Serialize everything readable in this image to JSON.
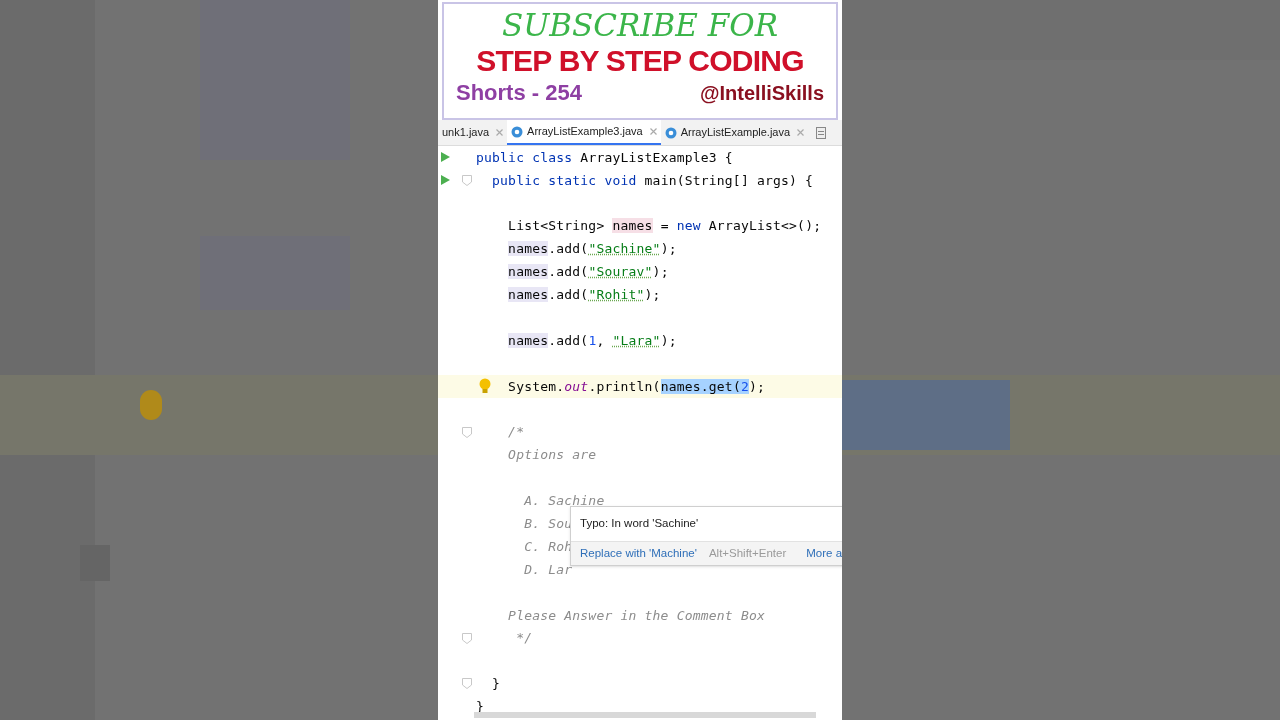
{
  "banner": {
    "headline": "SUBSCRIBE FOR",
    "subhead": "STEP BY STEP CODING",
    "episode": "Shorts - 254",
    "channel": "@IntelliSkills"
  },
  "tabs": [
    {
      "label": "unk1.java",
      "selected": false,
      "kind": "plain"
    },
    {
      "label": "ArrayListExample3.java",
      "selected": true,
      "kind": "class"
    },
    {
      "label": "ArrayListExample.java",
      "selected": false,
      "kind": "class"
    }
  ],
  "lines": [
    {
      "run": true,
      "fold": false,
      "current": false,
      "segments": [
        {
          "text": "public class",
          "kind": "keyword"
        },
        {
          "text": " ArrayListExample3 {",
          "kind": "plain"
        }
      ]
    },
    {
      "run": true,
      "fold": true,
      "current": false,
      "segments": [
        {
          "text": "  public static void",
          "kind": "keyword"
        },
        {
          "text": " main(String[] args) {",
          "kind": "plain"
        }
      ]
    },
    {
      "run": false,
      "fold": false,
      "current": false
    },
    {
      "run": false,
      "fold": false,
      "current": false,
      "segments": [
        {
          "text": "    List<String> ",
          "kind": "plain"
        },
        {
          "text": "names",
          "kind": "plain",
          "declaration": true
        },
        {
          "text": " = ",
          "kind": "plain"
        },
        {
          "text": "new",
          "kind": "keyword"
        },
        {
          "text": " ArrayList<>();",
          "kind": "plain"
        }
      ]
    },
    {
      "run": false,
      "fold": false,
      "current": false,
      "segments": [
        {
          "text": "    names",
          "kind": "plain",
          "usage": true
        },
        {
          "text": ".add(",
          "kind": "plain"
        },
        {
          "text": "\"Sachine\"",
          "kind": "string"
        },
        {
          "text": ");",
          "kind": "plain"
        }
      ]
    },
    {
      "run": false,
      "fold": false,
      "current": false,
      "segments": [
        {
          "text": "    names",
          "kind": "plain",
          "usage": true
        },
        {
          "text": ".add(",
          "kind": "plain"
        },
        {
          "text": "\"Sourav\"",
          "kind": "string"
        },
        {
          "text": ");",
          "kind": "plain"
        }
      ]
    },
    {
      "run": false,
      "fold": false,
      "current": false,
      "segments": [
        {
          "text": "    names",
          "kind": "plain",
          "usage": true
        },
        {
          "text": ".add(",
          "kind": "plain"
        },
        {
          "text": "\"Rohit\"",
          "kind": "string"
        },
        {
          "text": ");",
          "kind": "plain"
        }
      ]
    },
    {
      "run": false,
      "fold": false,
      "current": false
    },
    {
      "run": false,
      "fold": false,
      "current": false,
      "segments": [
        {
          "text": "    names",
          "kind": "plain",
          "usage": true
        },
        {
          "text": ".add(",
          "kind": "plain"
        },
        {
          "text": "1",
          "kind": "number"
        },
        {
          "text": ", ",
          "kind": "plain"
        },
        {
          "text": "\"Lara\"",
          "kind": "string"
        },
        {
          "text": ");",
          "kind": "plain"
        }
      ]
    },
    {
      "run": false,
      "fold": false,
      "current": false
    },
    {
      "run": false,
      "fold": false,
      "current": true,
      "segments": [
        {
          "text": "    System.",
          "kind": "plain"
        },
        {
          "text": "out",
          "kind": "field"
        },
        {
          "text": ".println(",
          "kind": "plain"
        },
        {
          "text": "names.get(",
          "kind": "plain",
          "selected": true
        },
        {
          "text": "2",
          "kind": "number",
          "selected": true
        },
        {
          "text": ");",
          "kind": "plain"
        }
      ]
    },
    {
      "run": false,
      "fold": false,
      "current": false
    },
    {
      "run": false,
      "fold": true,
      "current": false,
      "segments": [
        {
          "text": "    /*",
          "kind": "comment"
        }
      ]
    },
    {
      "run": false,
      "fold": false,
      "current": false,
      "segments": [
        {
          "text": "    Options are",
          "kind": "comment"
        }
      ]
    },
    {
      "run": false,
      "fold": false,
      "current": false
    },
    {
      "run": false,
      "fold": false,
      "current": false,
      "segments": [
        {
          "text": "      A. Sachine",
          "kind": "comment"
        }
      ]
    },
    {
      "run": false,
      "fold": false,
      "current": false,
      "segments": [
        {
          "text": "      B. Sou",
          "kind": "comment"
        }
      ]
    },
    {
      "run": false,
      "fold": false,
      "current": false,
      "segments": [
        {
          "text": "      C. Roh",
          "kind": "comment"
        }
      ]
    },
    {
      "run": false,
      "fold": false,
      "current": false,
      "segments": [
        {
          "text": "      D. Lar",
          "kind": "comment"
        }
      ]
    },
    {
      "run": false,
      "fold": false,
      "current": false
    },
    {
      "run": false,
      "fold": false,
      "current": false,
      "segments": [
        {
          "text": "    Please Answer in the Comment Box",
          "kind": "comment"
        }
      ]
    },
    {
      "run": false,
      "fold": true,
      "current": false,
      "segments": [
        {
          "text": "     */",
          "kind": "comment"
        }
      ]
    },
    {
      "run": false,
      "fold": false,
      "current": false
    },
    {
      "run": false,
      "fold": true,
      "current": false,
      "segments": [
        {
          "text": "  }",
          "kind": "plain"
        }
      ]
    },
    {
      "run": false,
      "fold": false,
      "current": false,
      "segments": [
        {
          "text": "}",
          "kind": "plain"
        }
      ]
    }
  ],
  "tooltip": {
    "message": "Typo: In word 'Sachine'",
    "action": "Replace with 'Machine'",
    "shortcut": "Alt+Shift+Enter",
    "more": "More a"
  }
}
